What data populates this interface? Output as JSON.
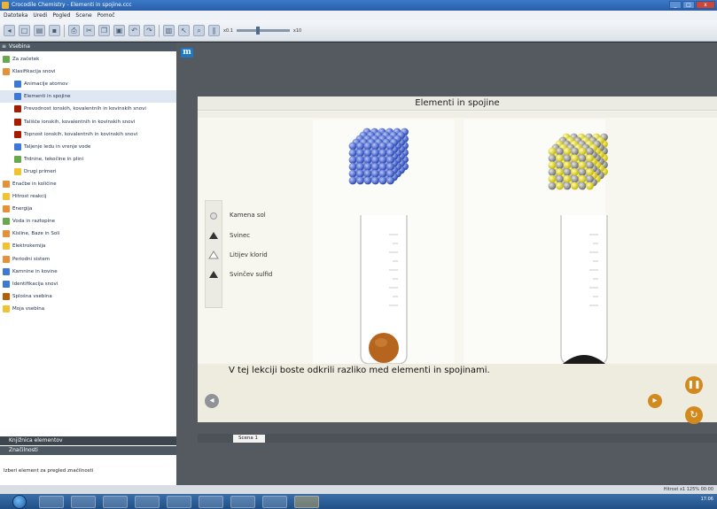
{
  "window": {
    "title": "Crocodile Chemistry - Elementi in spojine.ccc",
    "buttons": [
      "_",
      "□",
      "x"
    ]
  },
  "menu": [
    "Datoteka",
    "Uredi",
    "Pogled",
    "Scene",
    "Pomoč"
  ],
  "toolbar": {
    "zoom_min": "x0.1",
    "zoom_max": "x10"
  },
  "sidebar": {
    "header": "Vsebina",
    "items": [
      {
        "label": "Za začetek",
        "level": 0,
        "icon": "#6aa84f"
      },
      {
        "label": "Klasifikacija snovi",
        "level": 0,
        "icon": "#e69138"
      },
      {
        "label": "Animacije atomov",
        "level": 1,
        "icon": "#3c78d8"
      },
      {
        "label": "Elementi in spojine",
        "level": 1,
        "icon": "#3c78d8",
        "selected": true
      },
      {
        "label": "Prevodnost ionskih, kovalentnih in kovinskih snovi",
        "level": 1,
        "icon": "#a61c00"
      },
      {
        "label": "Tališče ionskih, kovalentnih in kovinskih snovi",
        "level": 1,
        "icon": "#a61c00"
      },
      {
        "label": "Topnost ionskih, kovalentnih in kovinskih snovi",
        "level": 1,
        "icon": "#a61c00"
      },
      {
        "label": "Taljenje ledu in vrenje vode",
        "level": 1,
        "icon": "#3c78d8"
      },
      {
        "label": "Trdnine, tekočine in plini",
        "level": 1,
        "icon": "#6aa84f"
      },
      {
        "label": "Drugi primeri",
        "level": 1,
        "icon": "#f1c232"
      },
      {
        "label": "Enačbe in količine",
        "level": 0,
        "icon": "#e69138"
      },
      {
        "label": "Hitrost reakcij",
        "level": 0,
        "icon": "#f1c232"
      },
      {
        "label": "Energija",
        "level": 0,
        "icon": "#e69138"
      },
      {
        "label": "Voda in raztopine",
        "level": 0,
        "icon": "#6aa84f"
      },
      {
        "label": "Kisline, Baze in Soli",
        "level": 0,
        "icon": "#e69138"
      },
      {
        "label": "Elektrokemija",
        "level": 0,
        "icon": "#f1c232"
      },
      {
        "label": "Periodni sistem",
        "level": 0,
        "icon": "#e69138"
      },
      {
        "label": "Kamnine in kovine",
        "level": 0,
        "icon": "#3c78d8"
      },
      {
        "label": "Identifikacija snovi",
        "level": 0,
        "icon": "#3c78d8"
      },
      {
        "label": "Splošna vsebina",
        "level": 0,
        "icon": "#b45f06"
      },
      {
        "label": "Moja vsebina",
        "level": 0,
        "icon": "#f1c232"
      }
    ],
    "lower_header_1": "Knjižnica elementov",
    "lower_header_2": "Značilnosti",
    "lower_text": "Izberi element za pregled značilnosti"
  },
  "stage": {
    "title": "Elementi in spojine",
    "legend": [
      {
        "label": "Kamena sol",
        "icon": "flask-icon"
      },
      {
        "label": "Svinec",
        "icon": "cone-icon"
      },
      {
        "label": "Litijev klorid",
        "icon": "cone-outline-icon"
      },
      {
        "label": "Svinčev sulfid",
        "icon": "cone-icon"
      }
    ],
    "caption": "V tej lekciji boste odkrili razliko med elementi in spojinami."
  },
  "scene_tab": "Scena 1",
  "statusbar": {
    "zoom": "Hitrost x1  125%  00:00"
  },
  "taskbar": {
    "clock": "17:06"
  }
}
